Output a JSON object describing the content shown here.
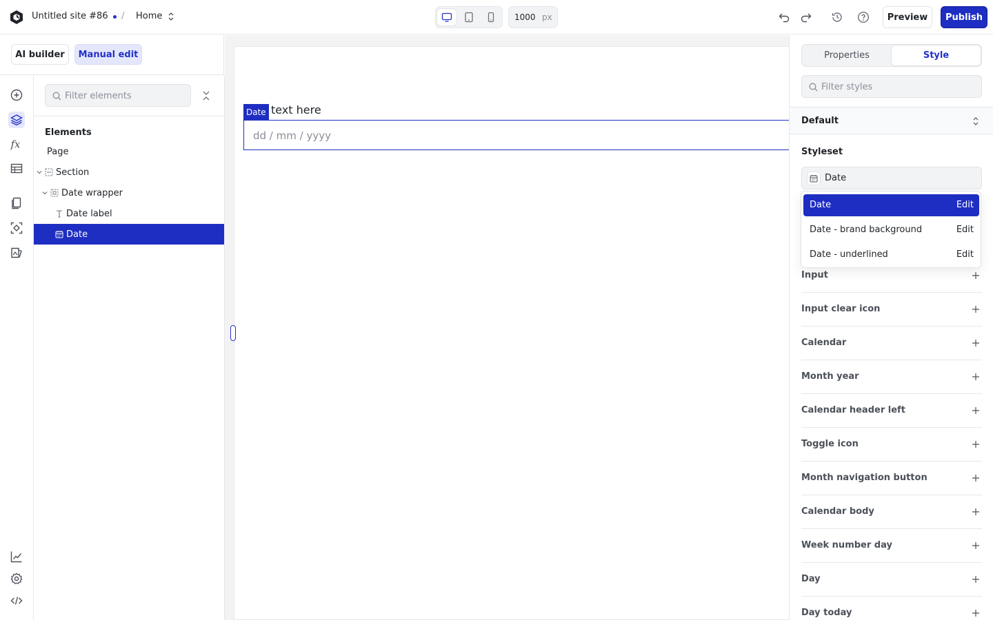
{
  "header": {
    "site_name": "Untitled site #86",
    "separator": "/",
    "page": "Home",
    "canvas_width": "1000",
    "canvas_unit": "px",
    "preview_label": "Preview",
    "publish_label": "Publish",
    "accent_color": "#1e2ec2"
  },
  "mode": {
    "ai_builder": "AI builder",
    "manual_edit": "Manual edit",
    "active": "Manual edit"
  },
  "rail": {
    "top_icons": [
      "add-icon",
      "layers-icon",
      "formula-icon",
      "data-table-icon",
      "pages-icon",
      "components-icon",
      "assets-icon"
    ],
    "bottom_icons": [
      "analytics-icon",
      "settings-icon",
      "code-icon"
    ],
    "active": "layers-icon"
  },
  "layers": {
    "filter_placeholder": "Filter elements",
    "title": "Elements",
    "tree": [
      {
        "label": "Page"
      },
      {
        "label": "Section"
      },
      {
        "label": "Date wrapper"
      },
      {
        "label": "Date label"
      },
      {
        "label": "Date"
      }
    ],
    "selected": "Date"
  },
  "canvas": {
    "tag": "Date",
    "label": "text here",
    "placeholder": "dd / mm / yyyy"
  },
  "panel": {
    "tabs": {
      "properties": "Properties",
      "style": "Style"
    },
    "active_tab": "Style",
    "filter_placeholder": "Filter styles",
    "state": "Default",
    "styleset_title": "Styleset",
    "styleset_value": "Date",
    "dropdown": [
      {
        "label": "Date",
        "action": "Edit"
      },
      {
        "label": "Date - brand background",
        "action": "Edit"
      },
      {
        "label": "Date - underlined",
        "action": "Edit"
      }
    ],
    "sections": [
      "Input",
      "Input clear icon",
      "Calendar",
      "Month year",
      "Calendar header left",
      "Toggle icon",
      "Month navigation button",
      "Calendar body",
      "Week number day",
      "Day",
      "Day today"
    ]
  }
}
